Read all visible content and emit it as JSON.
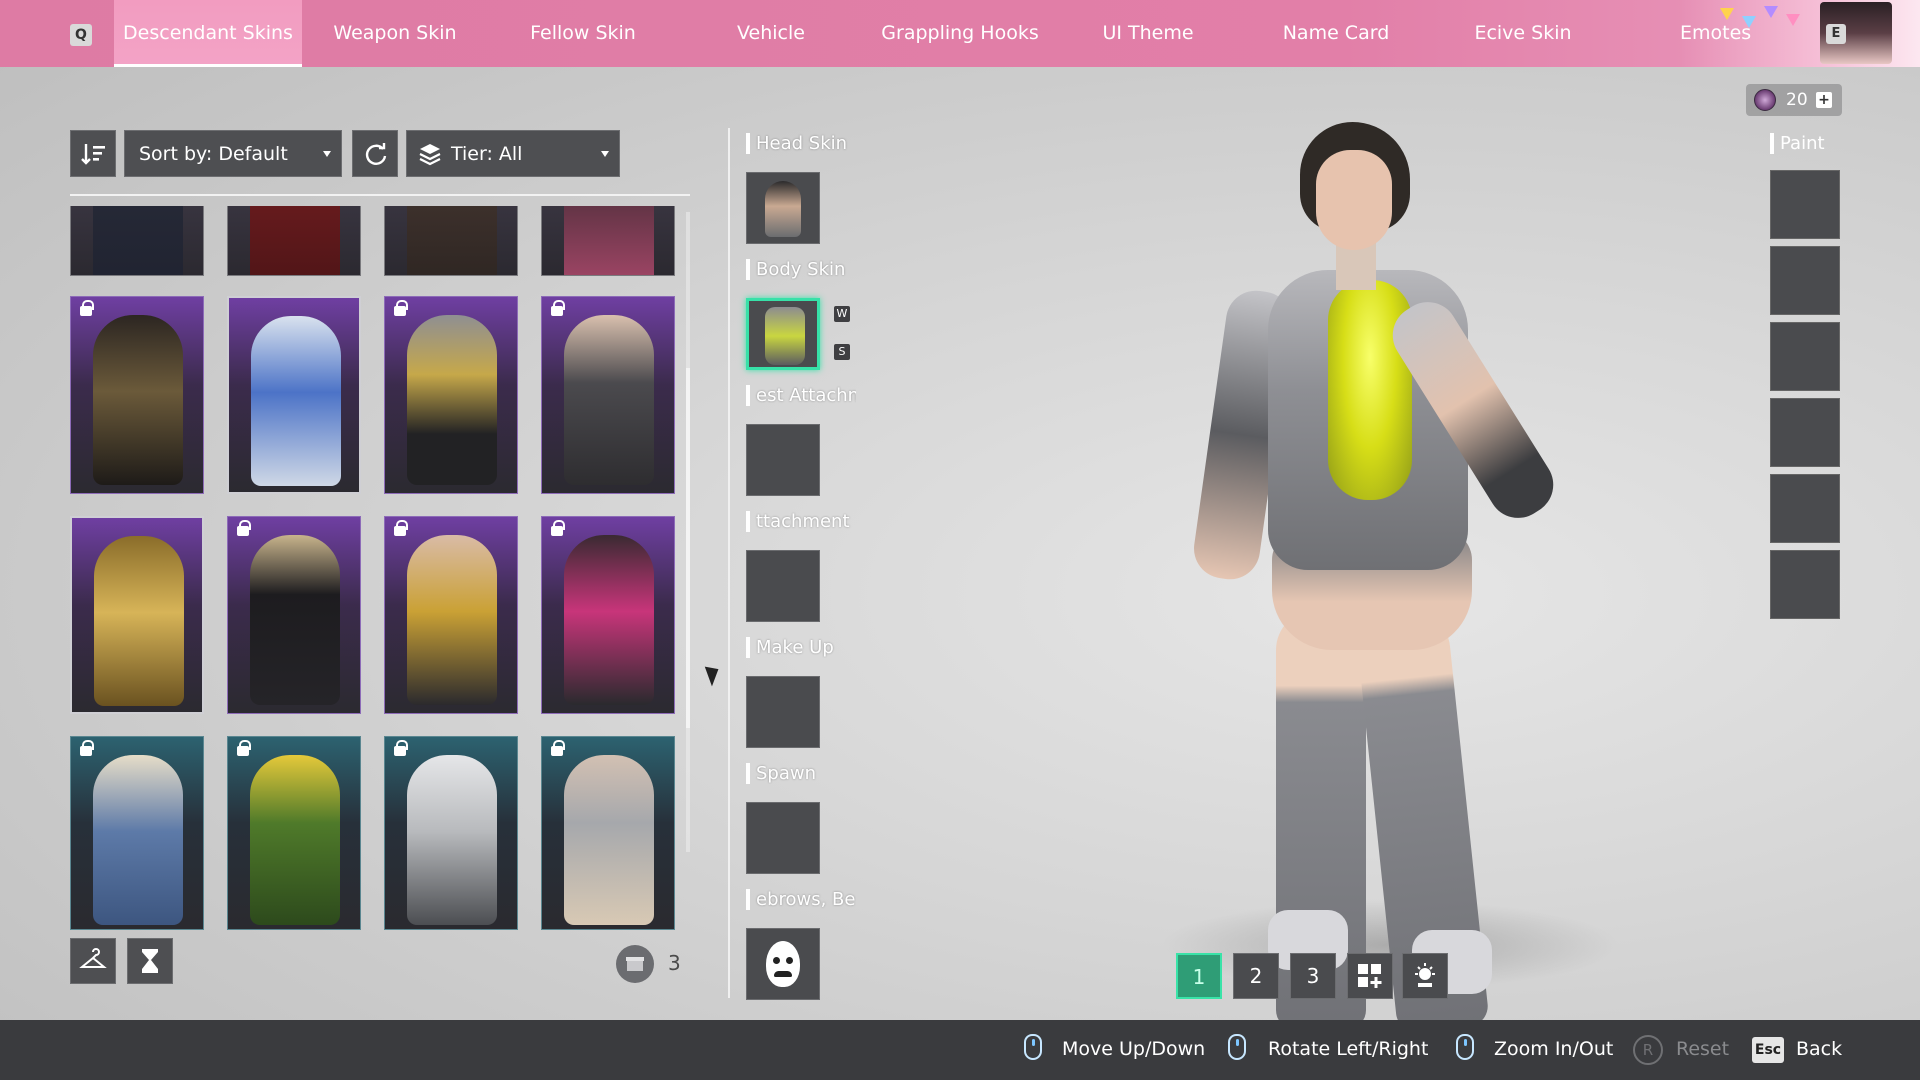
{
  "tabs": {
    "key_left": "Q",
    "key_right": "E",
    "items": [
      {
        "label": "Descendant Skins",
        "active": true
      },
      {
        "label": "Weapon Skin"
      },
      {
        "label": "Fellow Skin"
      },
      {
        "label": "Vehicle"
      },
      {
        "label": "Grappling Hooks"
      },
      {
        "label": "UI Theme"
      },
      {
        "label": "Name Card"
      },
      {
        "label": "Ecive Skin"
      },
      {
        "label": "Emotes"
      }
    ]
  },
  "toolbar": {
    "sort_icon": "sort-order-icon",
    "sort_label": "Sort by: Default",
    "reset_icon": "refresh-icon",
    "tier_icon": "layers-icon",
    "tier_label": "Tier: All"
  },
  "skins": {
    "rows": [
      [
        {
          "locked": false,
          "rarity": "normal"
        },
        {
          "locked": false,
          "rarity": "normal"
        },
        {
          "locked": false,
          "rarity": "normal"
        },
        {
          "locked": false,
          "rarity": "normal"
        }
      ],
      [
        {
          "locked": true,
          "rarity": "purple"
        },
        {
          "locked": false,
          "rarity": "purple",
          "featured": true
        },
        {
          "locked": true,
          "rarity": "purple"
        },
        {
          "locked": true,
          "rarity": "purple"
        }
      ],
      [
        {
          "locked": false,
          "rarity": "purple"
        },
        {
          "locked": true,
          "rarity": "purple"
        },
        {
          "locked": true,
          "rarity": "purple"
        },
        {
          "locked": true,
          "rarity": "purple"
        }
      ],
      [
        {
          "locked": true,
          "rarity": "teal"
        },
        {
          "locked": true,
          "rarity": "teal"
        },
        {
          "locked": true,
          "rarity": "teal"
        },
        {
          "locked": true,
          "rarity": "teal"
        }
      ]
    ],
    "bottom_buttons": [
      "hanger-icon",
      "hourglass-icon"
    ],
    "inventory_count": "3"
  },
  "slots": {
    "items": [
      {
        "label": "Head Skin",
        "filled": true
      },
      {
        "label": "Body Skin",
        "filled": true,
        "selected": true,
        "keys": [
          "W",
          "S"
        ]
      },
      {
        "label": "est Attachn",
        "filled": false
      },
      {
        "label": "ttachment",
        "filled": false
      },
      {
        "label": "Make Up",
        "filled": false
      },
      {
        "label": "Spawn",
        "filled": false
      },
      {
        "label": "ebrows, Be",
        "filled": true,
        "icon": "face-mustache-icon"
      }
    ]
  },
  "currency": {
    "value": "20",
    "plus": "+"
  },
  "paint": {
    "label": "Paint",
    "slot_count": 6
  },
  "presets": {
    "items": [
      "1",
      "2",
      "3"
    ],
    "active": "1",
    "extra_icons": [
      "add-preset-icon",
      "lighting-icon"
    ]
  },
  "hints": {
    "move": "Move Up/Down",
    "rotate": "Rotate Left/Right",
    "zoom": "Zoom In/Out",
    "reset_key": "R",
    "reset": "Reset",
    "back_key": "Esc",
    "back": "Back"
  },
  "colors": {
    "tab_bar": "#e07ea7",
    "selected_accent": "#37e1a8",
    "panel_button": "#4e4f52",
    "bottom_bar": "#3a3b3e"
  }
}
